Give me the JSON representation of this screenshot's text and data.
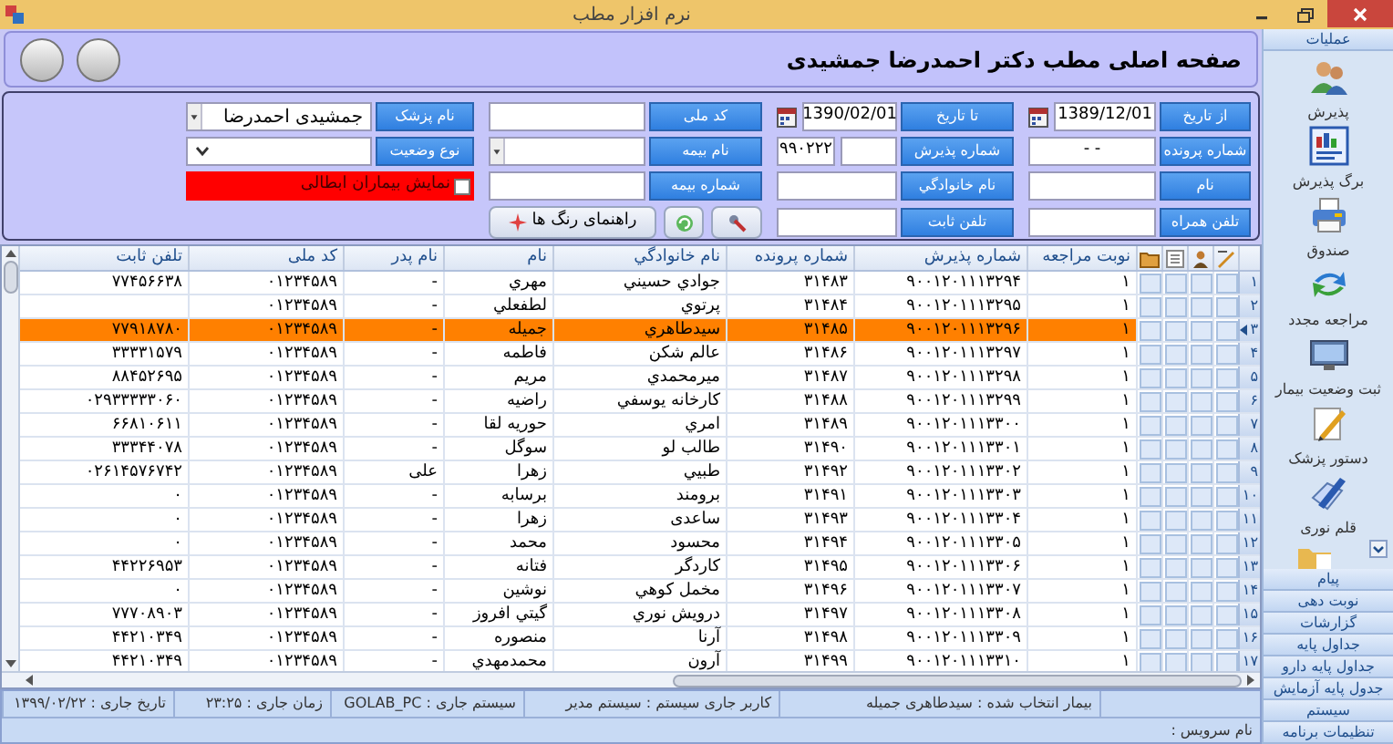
{
  "window": {
    "title": "نرم افزار مطب"
  },
  "header": {
    "title": "صفحه اصلی مطب دکتر احمدرضا جمشیدی"
  },
  "filters": [
    [
      {
        "kind": "date",
        "label": "از تاریخ",
        "value": "1389/12/01"
      },
      {
        "kind": "date",
        "label": "تا تاریخ",
        "value": "1390/02/01"
      },
      {
        "kind": "text",
        "label": "کد ملی"
      },
      {
        "kind": "combo",
        "label": "نام پزشک",
        "value": "جمشیدی احمدرضا"
      }
    ],
    [
      {
        "kind": "text",
        "label": "شماره پرونده",
        "value": "-  -"
      },
      {
        "kind": "pair",
        "label": "شماره پذیرش",
        "value": "۹۹۰۲۲۲"
      },
      {
        "kind": "combo",
        "label": "نام بیمه"
      },
      {
        "kind": "select",
        "label": "نوع وضعیت"
      }
    ],
    [
      {
        "kind": "text",
        "label": "نام"
      },
      {
        "kind": "text",
        "label": "نام خانوادگي"
      },
      {
        "kind": "text",
        "label": "شماره بیمه"
      },
      {
        "kind": "check",
        "label": "نمایش بیماران ابطالی",
        "checked": false
      }
    ],
    [
      {
        "kind": "text",
        "label": "تلفن همراه"
      },
      {
        "kind": "text",
        "label": "تلفن ثابت"
      },
      {
        "kind": "actions",
        "label": "راهنمای رنگ ها"
      }
    ]
  ],
  "table": {
    "columns": [
      "نوبت مراجعه",
      "شماره پذیرش",
      "شماره پرونده",
      "نام خانوادگي",
      "نام",
      "نام پدر",
      "کد ملی",
      "تلفن ثابت"
    ],
    "rows": [
      {
        "index": "۱",
        "selected": false,
        "cells": [
          "۱",
          "۹۰۰۱۲۰۱۱۱۳۲۹۴",
          "۳۱۴۸۳",
          "جوادي حسيني",
          "مهري",
          "-",
          "۰۱۲۳۴۵۸۹",
          "۷۷۴۵۶۶۳۸"
        ]
      },
      {
        "index": "۲",
        "selected": false,
        "cells": [
          "۱",
          "۹۰۰۱۲۰۱۱۱۳۲۹۵",
          "۳۱۴۸۴",
          "پرتوي",
          "لطفعلي",
          "-",
          "۰۱۲۳۴۵۸۹"
        ]
      },
      {
        "index": "۳",
        "selected": true,
        "cells": [
          "۱",
          "۹۰۰۱۲۰۱۱۱۳۲۹۶",
          "۳۱۴۸۵",
          "سيدطاهري",
          "جميله",
          "-",
          "۰۱۲۳۴۵۸۹",
          "۷۷۹۱۸۷۸۰"
        ]
      },
      {
        "index": "۴",
        "selected": false,
        "cells": [
          "۱",
          "۹۰۰۱۲۰۱۱۱۳۲۹۷",
          "۳۱۴۸۶",
          "عالم شكن",
          "فاطمه",
          "-",
          "۰۱۲۳۴۵۸۹",
          "۳۳۳۳۱۵۷۹"
        ]
      },
      {
        "index": "۵",
        "selected": false,
        "cells": [
          "۱",
          "۹۰۰۱۲۰۱۱۱۳۲۹۸",
          "۳۱۴۸۷",
          "ميرمحمدي",
          "مريم",
          "-",
          "۰۱۲۳۴۵۸۹",
          "۸۸۴۵۲۶۹۵"
        ]
      },
      {
        "index": "۶",
        "selected": false,
        "cells": [
          "۱",
          "۹۰۰۱۲۰۱۱۱۳۲۹۹",
          "۳۱۴۸۸",
          "كارخانه يوسفي",
          "راضيه",
          "-",
          "۰۱۲۳۴۵۸۹",
          "۰۲۹۳۳۳۳۳۰۶۰"
        ]
      },
      {
        "index": "۷",
        "selected": false,
        "cells": [
          "۱",
          "۹۰۰۱۲۰۱۱۱۳۳۰۰",
          "۳۱۴۸۹",
          "امري",
          "حوريه لقا",
          "-",
          "۰۱۲۳۴۵۸۹",
          "۶۶۸۱۰۶۱۱"
        ]
      },
      {
        "index": "۸",
        "selected": false,
        "cells": [
          "۱",
          "۹۰۰۱۲۰۱۱۱۳۳۰۱",
          "۳۱۴۹۰",
          "طالب لو",
          "سوگل",
          "-",
          "۰۱۲۳۴۵۸۹",
          "۳۳۳۴۴۰۷۸"
        ]
      },
      {
        "index": "۹",
        "selected": false,
        "cells": [
          "۱",
          "۹۰۰۱۲۰۱۱۱۳۳۰۲",
          "۳۱۴۹۲",
          "طبيي",
          "زهرا",
          "علی",
          "۰۱۲۳۴۵۸۹",
          "۰۲۶۱۴۵۷۶۷۴۲"
        ]
      },
      {
        "index": "۱۰",
        "selected": false,
        "cells": [
          "۱",
          "۹۰۰۱۲۰۱۱۱۳۳۰۳",
          "۳۱۴۹۱",
          "برومند",
          "برسابه",
          "-",
          "۰۱۲۳۴۵۸۹",
          "۰"
        ]
      },
      {
        "index": "۱۱",
        "selected": false,
        "cells": [
          "۱",
          "۹۰۰۱۲۰۱۱۱۳۳۰۴",
          "۳۱۴۹۳",
          "ساعدی",
          "زهرا",
          "-",
          "۰۱۲۳۴۵۸۹",
          "۰"
        ]
      },
      {
        "index": "۱۲",
        "selected": false,
        "cells": [
          "۱",
          "۹۰۰۱۲۰۱۱۱۳۳۰۵",
          "۳۱۴۹۴",
          "محسود",
          "محمد",
          "-",
          "۰۱۲۳۴۵۸۹",
          "۰"
        ]
      },
      {
        "index": "۱۳",
        "selected": false,
        "cells": [
          "۱",
          "۹۰۰۱۲۰۱۱۱۳۳۰۶",
          "۳۱۴۹۵",
          "كاردگر",
          "فتانه",
          "-",
          "۰۱۲۳۴۵۸۹",
          "۴۴۲۲۶۹۵۳"
        ]
      },
      {
        "index": "۱۴",
        "selected": false,
        "cells": [
          "۱",
          "۹۰۰۱۲۰۱۱۱۳۳۰۷",
          "۳۱۴۹۶",
          "مخمل كوهي",
          "نوشين",
          "-",
          "۰۱۲۳۴۵۸۹",
          "۰"
        ]
      },
      {
        "index": "۱۵",
        "selected": false,
        "cells": [
          "۱",
          "۹۰۰۱۲۰۱۱۱۳۳۰۸",
          "۳۱۴۹۷",
          "درويش نوري",
          "گيتي افروز",
          "-",
          "۰۱۲۳۴۵۸۹",
          "۷۷۷۰۸۹۰۳"
        ]
      },
      {
        "index": "۱۶",
        "selected": false,
        "cells": [
          "۱",
          "۹۰۰۱۲۰۱۱۱۳۳۰۹",
          "۳۱۴۹۸",
          "آرنا",
          "منصوره",
          "-",
          "۰۱۲۳۴۵۸۹",
          "۴۴۲۱۰۳۴۹"
        ]
      },
      {
        "index": "۱۷",
        "selected": false,
        "cells": [
          "۱",
          "۹۰۰۱۲۰۱۱۱۳۳۱۰",
          "۳۱۴۹۹",
          "آرون",
          "محمدمهدي",
          "-",
          "۰۱۲۳۴۵۸۹",
          "۴۴۲۱۰۳۴۹"
        ]
      }
    ]
  },
  "status_bar": {
    "items": [
      "بیمار انتخاب شده :  سیدطاهری جمیله",
      "کاربر جاری سیستم :  سیستم مدیر",
      "سیستم جاری :  GOLAB_PC",
      "زمان جاری :  ۲۳:۲۵",
      "تاریخ جاری :  ۱۳۹۹/۰۲/۲۲"
    ],
    "service": "نام سرویس :"
  },
  "sidebar": {
    "title": "عملیات",
    "items": [
      {
        "label": "پذیرش"
      },
      {
        "label": "برگ پذیرش"
      },
      {
        "label": "صندوق"
      },
      {
        "label": "مراجعه مجدد"
      },
      {
        "label": "ثبت وضعیت بیمار"
      },
      {
        "label": "دستور پزشک"
      },
      {
        "label": "قلم نوری"
      }
    ],
    "sections": [
      "پیام",
      "نوبت دهی",
      "گزارشات",
      "جداول پایه",
      "جداول پایه دارو",
      "جدول پایه آزمایش",
      "سیستم",
      "تنظیمات برنامه"
    ]
  }
}
